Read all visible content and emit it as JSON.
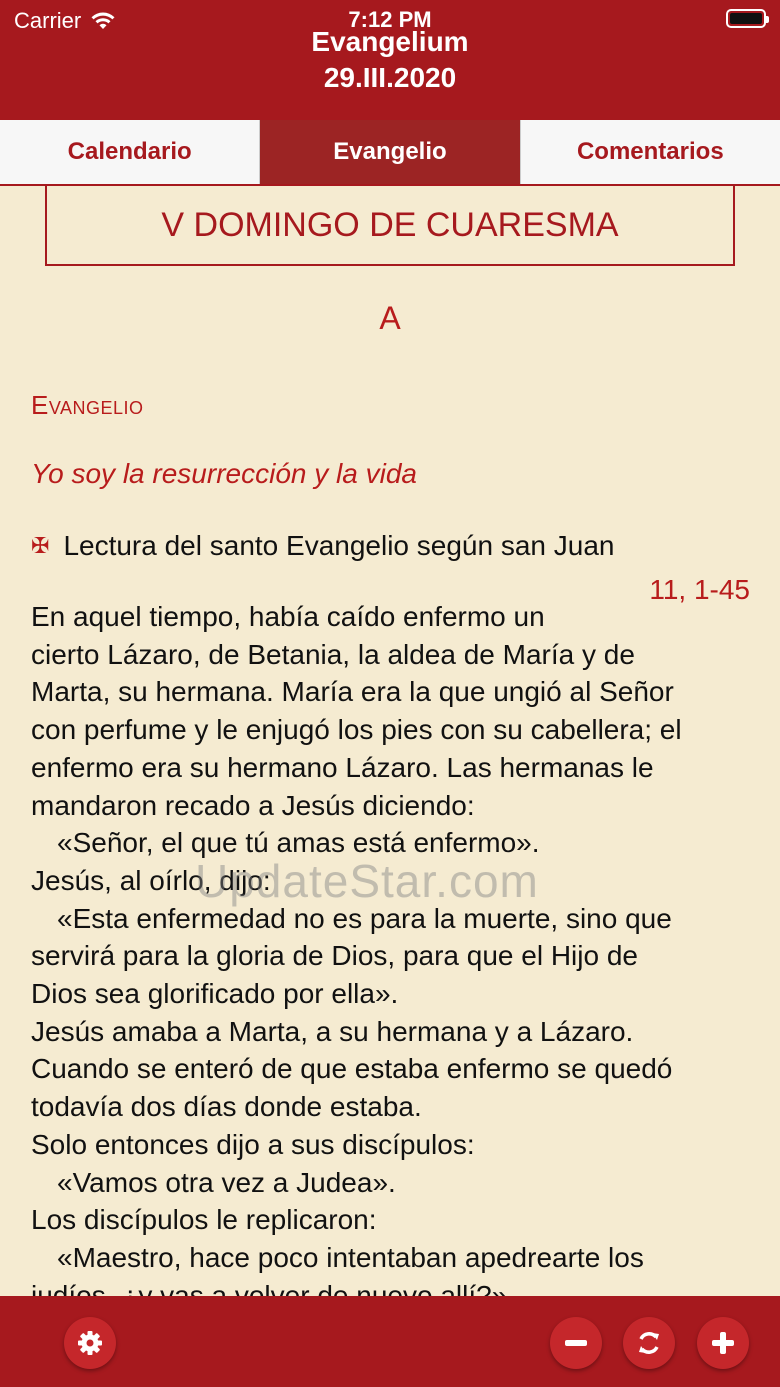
{
  "status_bar": {
    "carrier": "Carrier",
    "time": "7:12 PM"
  },
  "header": {
    "title": "Evangelium",
    "date": "29.III.2020"
  },
  "tabs": [
    {
      "label": "Calendario",
      "active": false
    },
    {
      "label": "Evangelio",
      "active": true
    },
    {
      "label": "Comentarios",
      "active": false
    }
  ],
  "content": {
    "day_title": "V DOMINGO DE CUARESMA",
    "cycle": "A",
    "section_label": "Evangelio",
    "subtitle": "Yo soy la resurrección y la vida",
    "reading_intro": "Lectura del santo Evangelio según san Juan",
    "reference": "11, 1-45",
    "lines": [
      "En aquel tiempo, había caído enfermo un",
      "cierto Lázaro, de Betania, la aldea de María y de",
      "Marta, su hermana. María era la que ungió al Señor",
      "con perfume y le enjugó los pies con su cabellera; el",
      "enfermo era su hermano Lázaro. Las hermanas le",
      "mandaron recado a Jesús diciendo:",
      "«Señor, el que tú amas está enfermo».",
      "Jesús, al oírlo, dijo:",
      "«Esta enfermedad no es para la muerte, sino que",
      "servirá para la gloria de Dios, para que el Hijo de",
      "Dios sea glorificado por ella».",
      "Jesús amaba a Marta, a su hermana y a Lázaro.",
      "Cuando se enteró de que estaba enfermo se quedó",
      "todavía dos días donde estaba.",
      "Solo entonces dijo a sus discípulos:",
      "«Vamos otra vez a Judea».",
      "Los discípulos le replicaron:",
      "«Maestro, hace poco intentaban apedrearte los",
      "judíos, ¿y vas a volver de nuevo allí?»."
    ],
    "indented_lines": [
      6,
      8,
      15,
      17
    ]
  },
  "watermark": "UpdateStar.com",
  "toolbar": {
    "icons": [
      "gear-icon",
      "minus-icon",
      "refresh-icon",
      "plus-icon"
    ],
    "accent": "#a6191e"
  },
  "colors": {
    "brand": "#a6191e",
    "background": "#f5ebd1",
    "accent_text": "#b81c1c"
  }
}
